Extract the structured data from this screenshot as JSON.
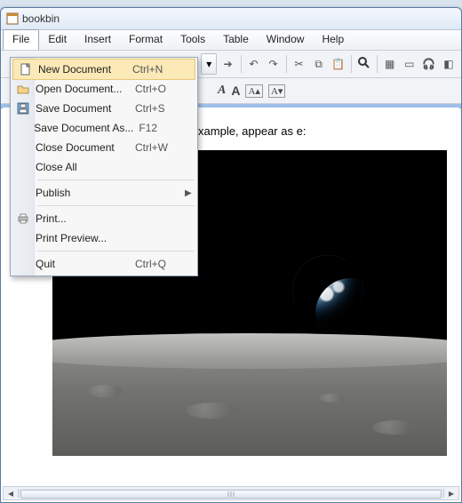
{
  "window": {
    "title": "bookbin"
  },
  "menubar": [
    "File",
    "Edit",
    "Insert",
    "Format",
    "Tools",
    "Table",
    "Window",
    "Help"
  ],
  "file_menu": {
    "open_item": "File",
    "items": [
      {
        "icon": "new-doc-icon",
        "label": "New Document",
        "shortcut": "Ctrl+N",
        "hl": true
      },
      {
        "icon": "open-doc-icon",
        "label": "Open Document...",
        "shortcut": "Ctrl+O"
      },
      {
        "icon": "save-doc-icon",
        "label": "Save Document",
        "shortcut": "Ctrl+S"
      },
      {
        "icon": "",
        "label": "Save Document As...",
        "shortcut": "F12"
      },
      {
        "icon": "",
        "label": "Close Document",
        "shortcut": "Ctrl+W"
      },
      {
        "icon": "",
        "label": "Close All",
        "shortcut": ""
      },
      {
        "sep": true
      },
      {
        "icon": "",
        "label": "Publish",
        "shortcut": "",
        "submenu": true
      },
      {
        "sep": true
      },
      {
        "icon": "print-icon",
        "label": "Print...",
        "shortcut": ""
      },
      {
        "icon": "",
        "label": "Print Preview...",
        "shortcut": ""
      },
      {
        "sep": true
      },
      {
        "icon": "",
        "label": "Quit",
        "shortcut": "Ctrl+Q"
      }
    ]
  },
  "body_text": "ully supported. Images, for example, appear as e:",
  "image": {
    "alt": "Earthrise photo — Earth over lunar horizon"
  },
  "toolbar_icons": {
    "dropdown": "▾",
    "forward": "➔",
    "undo": "↶",
    "redo": "↷",
    "cut": "✂",
    "copy": "⧉",
    "paste": "📋",
    "search": "🔍",
    "grid": "▦",
    "panel": "▭",
    "headphones": "🎧",
    "tag": "◧"
  },
  "format_icons": {
    "italicA": "A",
    "increase": "A▴",
    "decrease": "A▾"
  }
}
